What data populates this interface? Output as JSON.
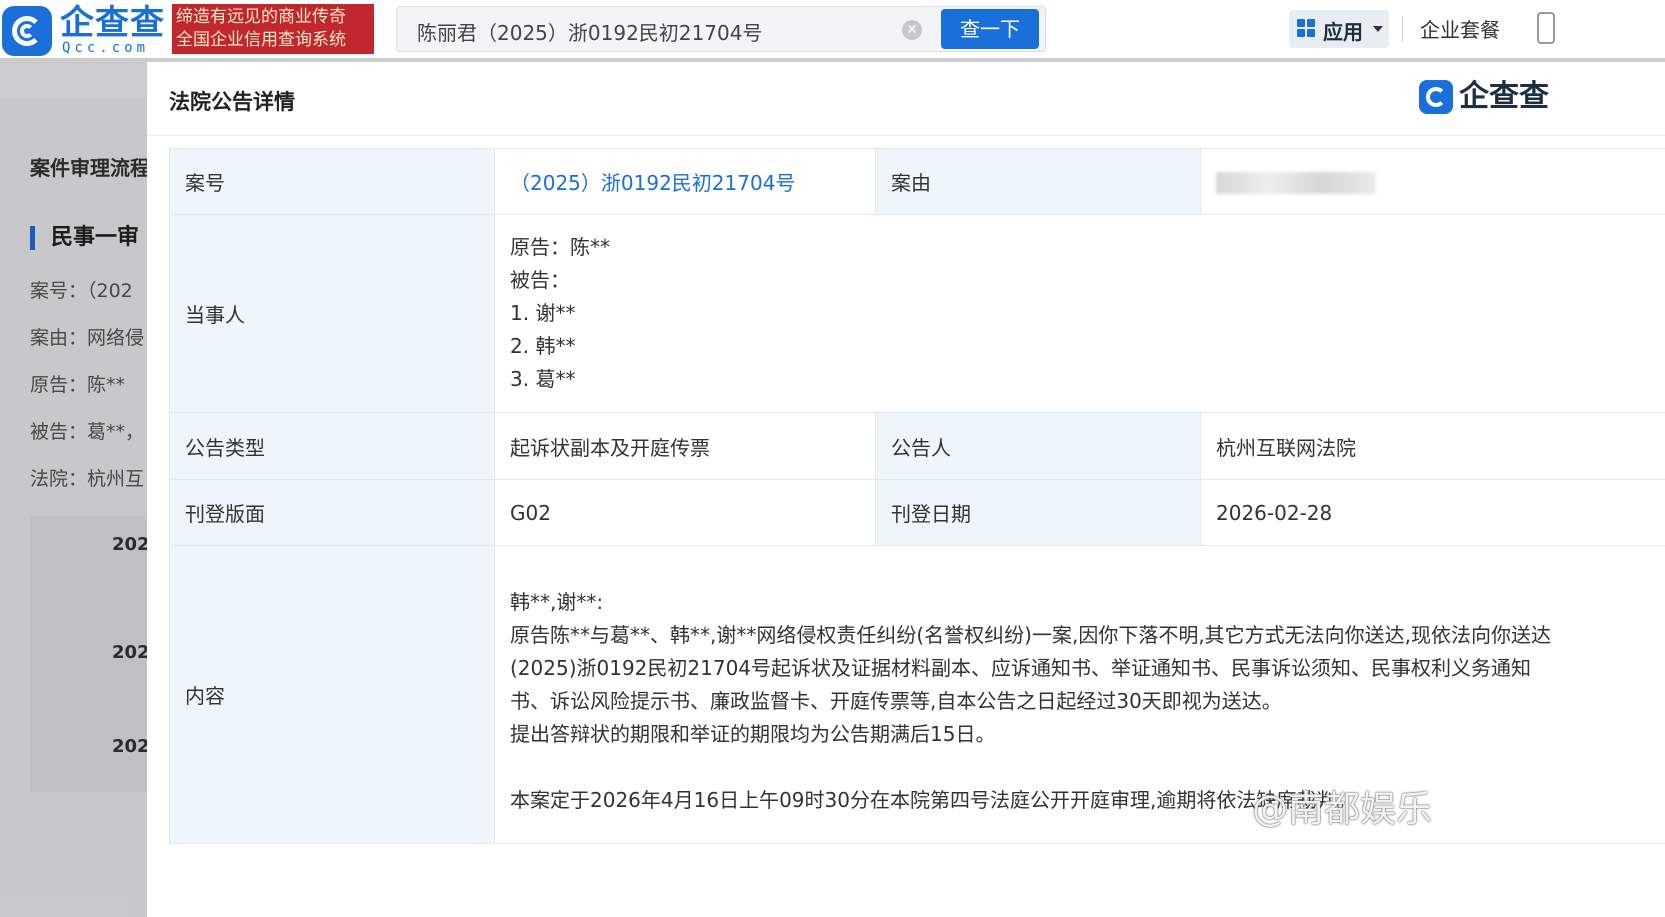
{
  "header": {
    "logo_cn": "企查查",
    "logo_en": "Qcc.com",
    "slogan_line1": "缔造有远见的商业传奇",
    "slogan_line2": "全国企业信用查询系统",
    "search_value": "陈丽君（2025）浙0192民初21704号",
    "search_button": "查一下",
    "apps_label": "应用",
    "packages_label": "企业套餐"
  },
  "background_page": {
    "section_title": "案件审理流程",
    "stage_title": "民事一审",
    "lines": [
      "案号：（202",
      "案由：网络侵",
      "原告：陈**",
      "被告：葛**，",
      "法院：杭州互"
    ],
    "years": [
      "202",
      "202",
      "202"
    ]
  },
  "modal": {
    "title": "法院公告详情",
    "brand": "企查查",
    "rows": {
      "case_no_label": "案号",
      "case_no_value": "（2025）浙0192民初21704号",
      "cause_label": "案由",
      "parties_label": "当事人",
      "parties": [
        "原告：陈**",
        "被告：",
        "1. 谢**",
        "2. 韩**",
        "3. 葛**"
      ],
      "notice_type_label": "公告类型",
      "notice_type_value": "起诉状副本及开庭传票",
      "announcer_label": "公告人",
      "announcer_value": "杭州互联网法院",
      "page_label": "刊登版面",
      "page_value": "G02",
      "date_label": "刊登日期",
      "date_value": "2026-02-28",
      "content_label": "内容",
      "content_lines": [
        "韩**,谢**:",
        "原告陈**与葛**、韩**,谢**网络侵权责任纠纷(名誉权纠纷)一案,因你下落不明,其它方式无法向你送达,现依法向你送达",
        "(2025)浙0192民初21704号起诉状及证据材料副本、应诉通知书、举证通知书、民事诉讼须知、民事权利义务通知",
        "书、诉讼风险提示书、廉政监督卡、开庭传票等,自本公告之日起经过30天即视为送达。",
        "提出答辩状的期限和举证的期限均为公告期满后15日。",
        "",
        "本案定于2026年4月16日上午09时30分在本院第四号法庭公开开庭审理,逾期将依法缺席裁判。"
      ]
    }
  },
  "watermark": "@南都娱乐",
  "colors": {
    "brand_blue": "#1a6fd8",
    "slogan_red": "#c0282d",
    "label_bg": "#eef5fd"
  }
}
